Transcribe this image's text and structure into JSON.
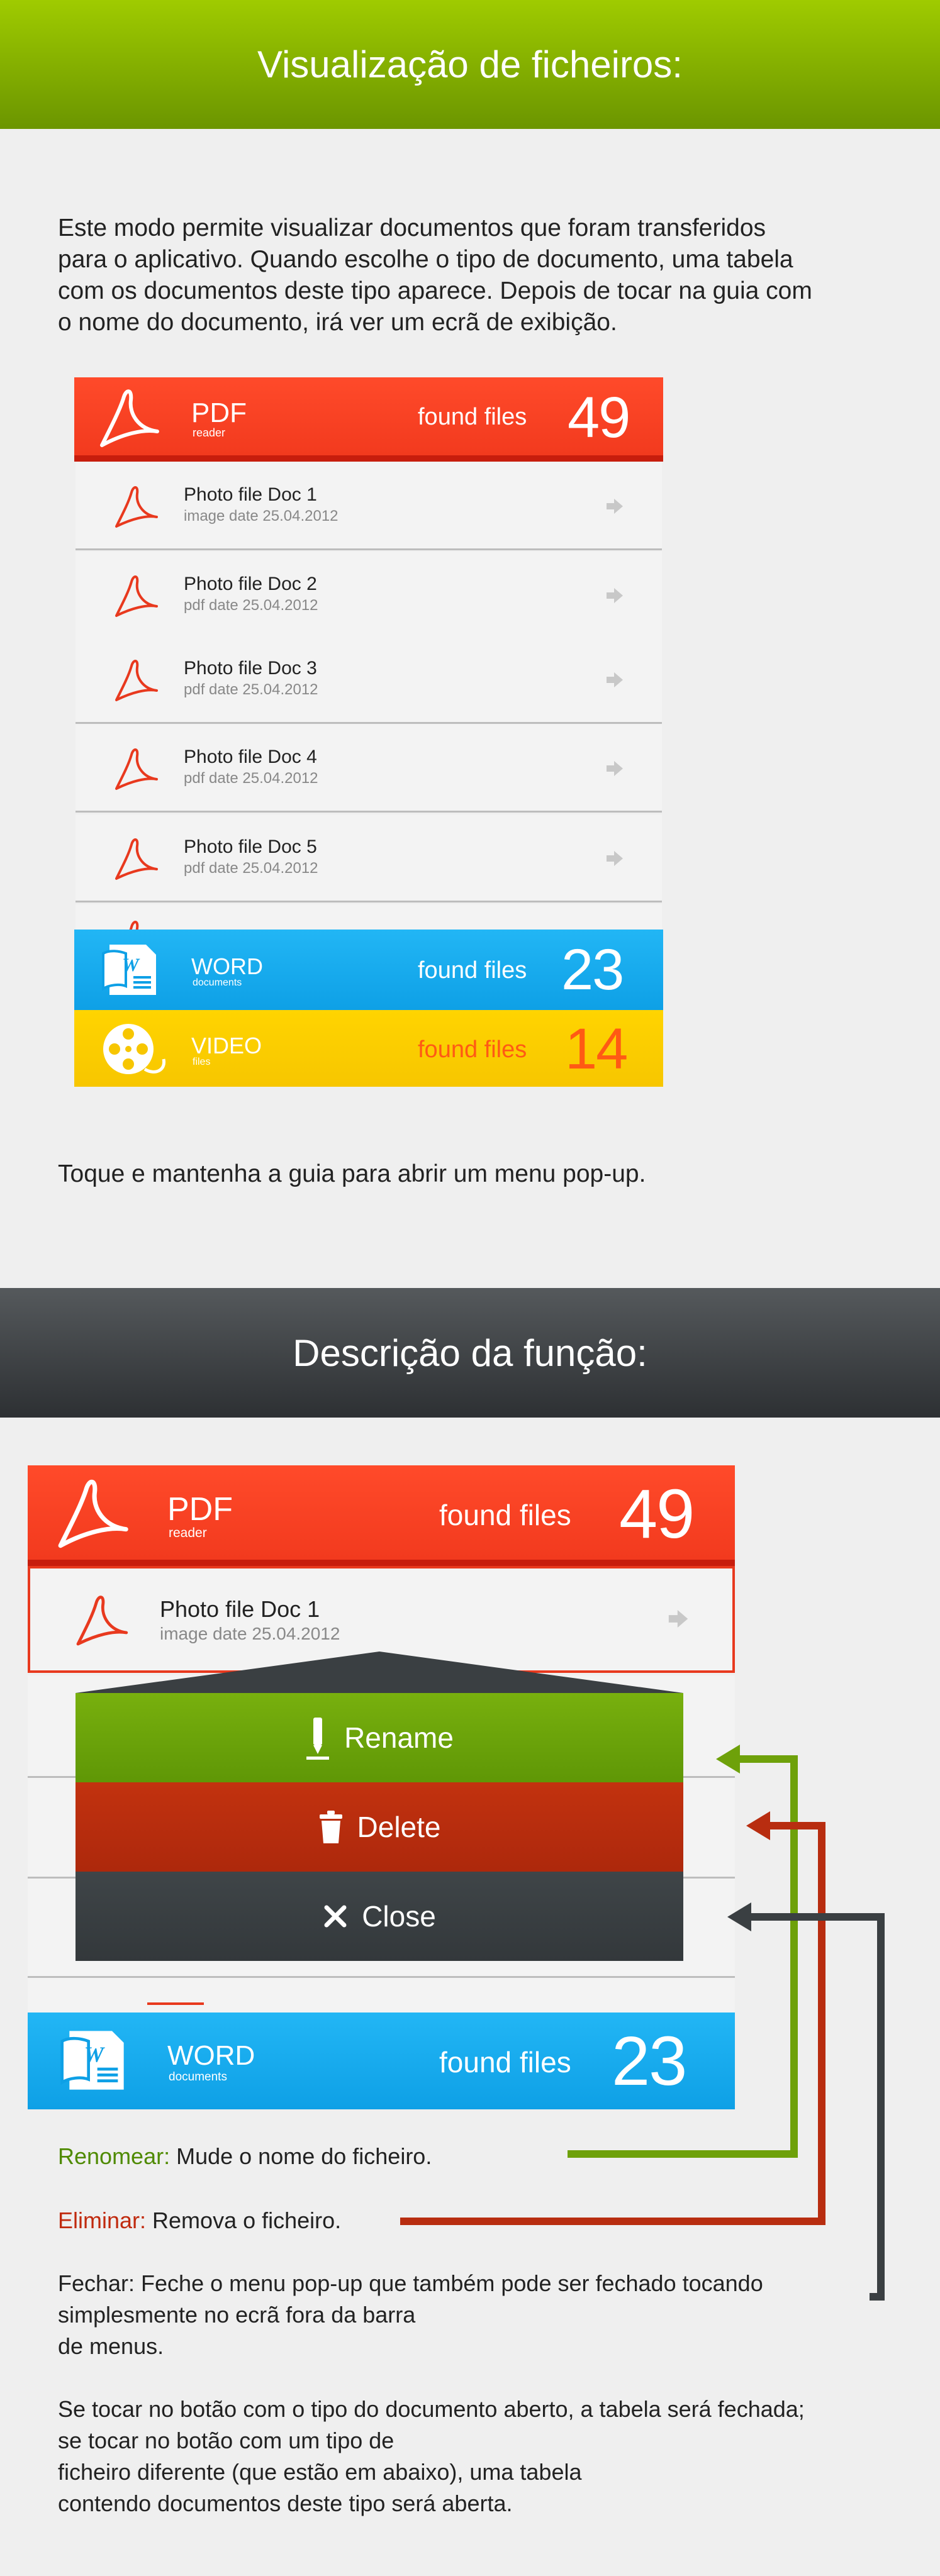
{
  "section1": {
    "title": "Visualização de ficheiros:",
    "intro_lines": [
      "Este modo permite visualizar documentos que foram transferidos",
      "para o aplicativo. Quando escolhe o tipo de documento, uma tabela",
      "com os documentos deste tipo aparece. Depois de tocar na guia com",
      "o nome do documento, irá ver um ecrã de exibição."
    ],
    "hint": "Toque e mantenha a guia para abrir um menu pop-up."
  },
  "panel1": {
    "pdf": {
      "name": "PDF",
      "sub": "reader",
      "found": "found files",
      "count": "49"
    },
    "rows": [
      {
        "title": "Photo file Doc 1",
        "sub": "image date 25.04.2012"
      },
      {
        "title": "Photo file Doc 2",
        "sub": "pdf date 25.04.2012"
      },
      {
        "title": "Photo file Doc 3",
        "sub": "pdf date 25.04.2012"
      },
      {
        "title": "Photo file Doc 4",
        "sub": "pdf date 25.04.2012"
      },
      {
        "title": "Photo file Doc 5",
        "sub": "pdf date 25.04.2012"
      }
    ],
    "word": {
      "name": "WORD",
      "sub": "documents",
      "found": "found files",
      "count": "23"
    },
    "video": {
      "name": "VIDEO",
      "sub": "files",
      "found": "found files",
      "count": "14"
    }
  },
  "section2": {
    "title": "Descrição da função:"
  },
  "panel2": {
    "pdf": {
      "name": "PDF",
      "sub": "reader",
      "found": "found files",
      "count": "49"
    },
    "row": {
      "title": "Photo file Doc 1",
      "sub": "image date 25.04.2012"
    },
    "menu": {
      "rename": "Rename",
      "delete": "Delete",
      "close": "Close"
    },
    "word": {
      "name": "WORD",
      "sub": "documents",
      "found": "found files",
      "count": "23"
    }
  },
  "descriptions": {
    "rename_key": "Renomear:",
    "rename_text": " Mude o nome do ficheiro.",
    "delete_key": "Eliminar:",
    "delete_text": "  Remova o ficheiro.",
    "close_lines": [
      "Fechar:  Feche o menu pop-up que também pode ser fechado tocando",
      "simplesmente no ecrã fora da barra",
      "de menus."
    ],
    "final_lines": [
      "Se tocar no botão com o tipo do documento aberto, a tabela será fechada;",
      "se tocar no botão com um tipo de",
      "ficheiro diferente (que estão em abaixo), uma tabela",
      "contendo documentos deste tipo será aberta."
    ]
  },
  "colors": {
    "green_banner": "#8ab800",
    "dark_banner": "#3a3d40",
    "pdf_red": "#f5401f",
    "word_blue": "#1aaef0",
    "video_yellow": "#fdd000",
    "rename_green": "#6ea10a",
    "delete_red": "#b82d10",
    "close_dark": "#3a3f42"
  },
  "icons": [
    "pdf-icon",
    "word-icon",
    "video-reel-icon",
    "arrow-right-icon",
    "pencil-icon",
    "trash-icon",
    "close-icon"
  ]
}
